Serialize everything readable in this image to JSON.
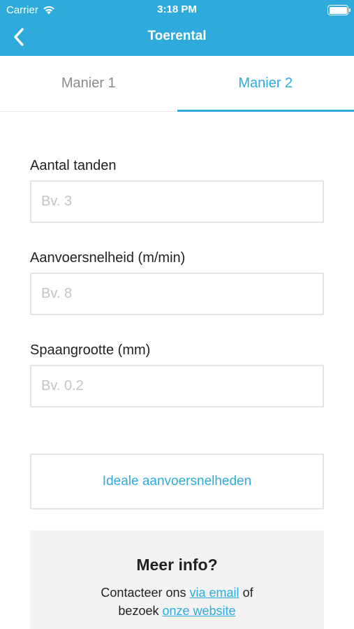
{
  "status_bar": {
    "carrier": "Carrier",
    "time": "3:18 PM"
  },
  "navbar": {
    "title": "Toerental",
    "back_icon": "chevron-left-icon"
  },
  "tabs": [
    {
      "label": "Manier 1",
      "active": false
    },
    {
      "label": "Manier 2",
      "active": true
    }
  ],
  "form": {
    "fields": [
      {
        "label": "Aantal tanden",
        "placeholder": "Bv. 3",
        "value": ""
      },
      {
        "label": "Aanvoersnelheid (m/min)",
        "placeholder": "Bv. 8",
        "value": ""
      },
      {
        "label": "Spaangrootte (mm)",
        "placeholder": "Bv. 0.2",
        "value": ""
      }
    ],
    "ideal_button_label": "Ideale aanvoersnelheden"
  },
  "info": {
    "title": "Meer info?",
    "line1_prefix": "Contacteer ons",
    "email_link": "via email",
    "line1_suffix": "of",
    "line2_prefix": "bezoek",
    "website_link": "onze website"
  },
  "colors": {
    "accent": "#2eabdc",
    "text": "#222222",
    "placeholder": "#c4c4c4",
    "border": "#e4e4e4",
    "info_bg": "#f3f3f3"
  }
}
